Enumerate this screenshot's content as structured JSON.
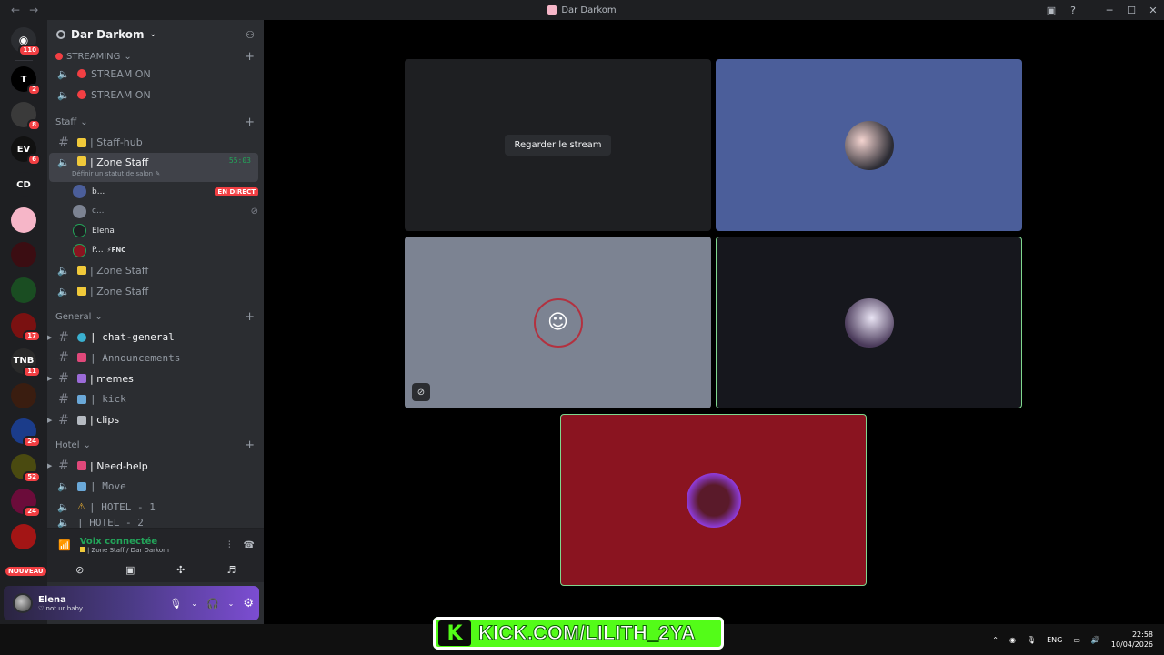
{
  "window": {
    "title": "Dar Darkom"
  },
  "rail": {
    "home_badge": "110",
    "servers": [
      {
        "initials": "T",
        "badge": "2",
        "color": "#000000"
      },
      {
        "initials": "",
        "badge": "8",
        "color": "#3a3a3a"
      },
      {
        "initials": "EV",
        "badge": "6",
        "color": "#111111"
      },
      {
        "initials": "CD",
        "badge": "",
        "color": "#1e1f22"
      },
      {
        "initials": "",
        "badge": "",
        "color": "#f6b6c8"
      },
      {
        "initials": "",
        "badge": "",
        "color": "#3b0d12"
      },
      {
        "initials": "",
        "badge": "",
        "color": "#1a4d22"
      },
      {
        "initials": "",
        "badge": "17",
        "color": "#7a1111"
      },
      {
        "initials": "TNB",
        "badge": "11",
        "color": "#2a2a2a"
      },
      {
        "initials": "",
        "badge": "",
        "color": "#3a1d10"
      },
      {
        "initials": "",
        "badge": "24",
        "color": "#1b3c8a"
      },
      {
        "initials": "",
        "badge": "52",
        "color": "#4a4a10"
      },
      {
        "initials": "",
        "badge": "24",
        "color": "#6b0c3a"
      },
      {
        "initials": "",
        "badge": "",
        "color": "#a31515"
      }
    ],
    "new_label": "NOUVEAU"
  },
  "sidebar": {
    "server_name": "Dar Darkom",
    "cat_streaming": "STREAMING",
    "stream_channels": [
      "STREAM ON",
      "STREAM ON"
    ],
    "cat_staff": "Staff",
    "staff_hub": "| Staff-hub",
    "zone_active": {
      "label": "| Zone Staff",
      "timer": "55:03",
      "status": "Définir un statut de salon"
    },
    "members": [
      {
        "name": "b...",
        "live": "EN DIRECT"
      },
      {
        "name": "c..."
      },
      {
        "name": "Elena"
      },
      {
        "name": "P...",
        "tag": "FNC"
      }
    ],
    "zone_more": [
      "| Zone Staff",
      "| Zone Staff"
    ],
    "cat_general": "General",
    "general_channels": [
      "| chat-general",
      "| Announcements",
      "| memes",
      "| kick",
      "| clips"
    ],
    "cat_hotel": "Hotel",
    "hotel_channels": [
      "| Need-help",
      "| Move",
      "| HOTEL - 1",
      "| HOTEL - 2"
    ]
  },
  "voice": {
    "status": "Voix connectée",
    "location": "| Zone Staff / Dar Darkom"
  },
  "user": {
    "name": "Elena",
    "status": "not ur baby"
  },
  "stage": {
    "watch_stream": "Regarder le stream"
  },
  "overlay": {
    "kick_url": "KICK.COM/LILITH_2YA",
    "kick_letter": "K"
  },
  "taskbar": {
    "lang": "ENG",
    "time": "22:58",
    "date": "10/04/2026"
  }
}
